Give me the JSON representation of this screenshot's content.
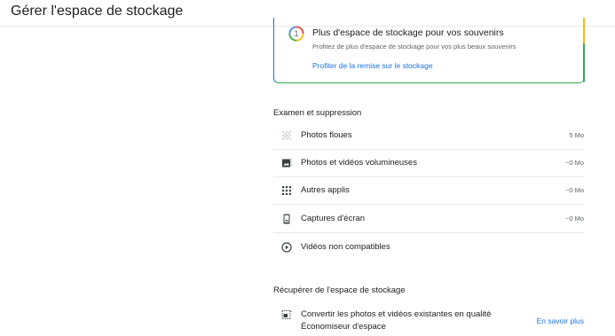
{
  "header": {
    "title": "Gérer l'espace de stockage"
  },
  "promo": {
    "badge": "1",
    "title": "Plus d'espace de stockage pour vos souvenirs",
    "subtitle": "Profitez de plus d'espace de stockage pour vos plus beaux souvenirs",
    "link": "Profiter de la remise sur le stockage"
  },
  "review": {
    "title": "Examen et suppression",
    "items": [
      {
        "label": "Photos floues",
        "value": "5 Mo",
        "icon": "blur-grid-icon"
      },
      {
        "label": "Photos et vidéos volumineuses",
        "value": "~0 Mo",
        "icon": "large-media-icon"
      },
      {
        "label": "Autres applis",
        "value": "~0 Mo",
        "icon": "apps-grid-icon"
      },
      {
        "label": "Captures d'écran",
        "value": "~0 Mo",
        "icon": "screenshot-icon"
      },
      {
        "label": "Vidéos non compatibles",
        "value": "",
        "icon": "play-circle-icon"
      }
    ]
  },
  "recover": {
    "title": "Récupérer de l'espace de stockage",
    "convert_line1": "Convertir les photos et vidéos existantes en qualité",
    "convert_line2": "Économiseur d'espace",
    "link": "En savoir plus",
    "icon": "compress-media-icon"
  },
  "colors": {
    "accent": "#1a73e8",
    "google_red": "#ea4335",
    "google_yellow": "#fbbc04",
    "google_green": "#34a853",
    "text": "#202124",
    "muted": "#5f6368",
    "divider": "#e8eaed"
  }
}
